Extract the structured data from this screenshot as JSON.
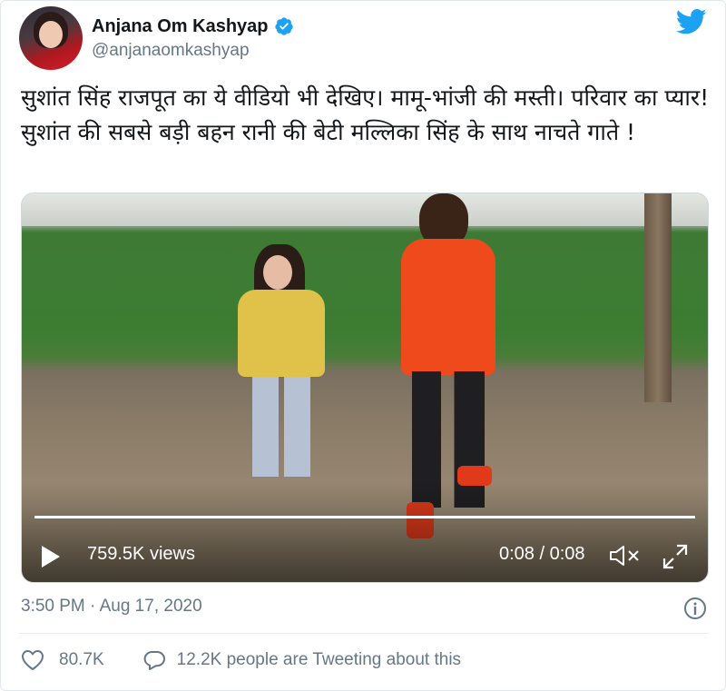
{
  "author": {
    "display_name": "Anjana Om Kashyap",
    "handle": "@anjanaomkashyap",
    "avatar_icon": "avatar",
    "verified_icon": "verified-badge-icon",
    "brand_icon": "twitter-bird-icon"
  },
  "tweet": {
    "text": "सुशांत सिंह राजपूत का ये वीडियो भी देखिए। मामू-भांजी की मस्ती। परिवार का प्यार! सुशांत की सबसे बड़ी बहन रानी की बेटी मल्लिका सिंह के साथ नाचते गाते !"
  },
  "video": {
    "views": "759.5K views",
    "time": "0:08 / 0:08",
    "progress": 1.0,
    "play_icon": "play-icon",
    "mute_icon": "mute-icon",
    "fullscreen_icon": "fullscreen-icon"
  },
  "meta": {
    "timestamp": "3:50 PM · Aug 17, 2020",
    "info_icon": "info-icon"
  },
  "actions": {
    "likes": "80.7K",
    "replies_text": "12.2K people are Tweeting about this",
    "like_icon": "heart-icon",
    "reply_icon": "speech-bubble-icon"
  },
  "colors": {
    "brand_blue": "#1da1f2",
    "muted_text": "#657786",
    "text": "#14171a"
  }
}
